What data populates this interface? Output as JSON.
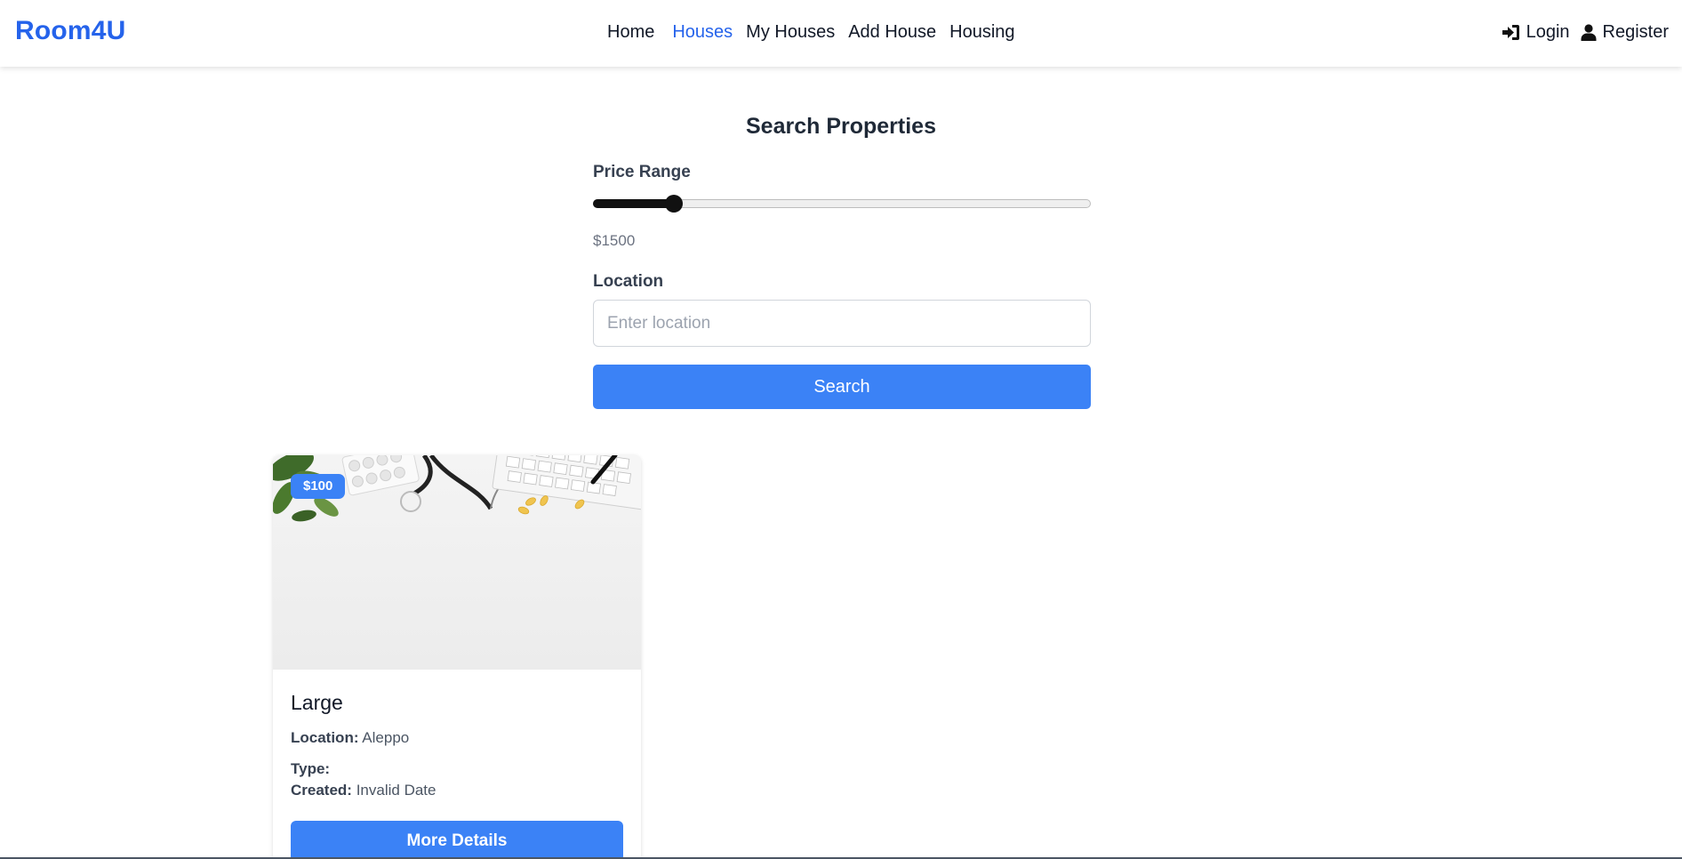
{
  "navbar": {
    "brand": "Room4U",
    "links": [
      {
        "label": "Home",
        "active": false
      },
      {
        "label": "Houses",
        "active": true
      },
      {
        "label": "My Houses",
        "active": false
      },
      {
        "label": "Add House",
        "active": false
      },
      {
        "label": "Housing",
        "active": false
      }
    ],
    "login_label": "Login",
    "register_label": "Register",
    "login_icon": "sign-in-icon",
    "register_icon": "user-icon"
  },
  "search": {
    "title": "Search Properties",
    "price_label": "Price Range",
    "price_value_text": "$1500",
    "price_slider_fraction": 0.163,
    "location_label": "Location",
    "location_value": "",
    "location_placeholder": "Enter location",
    "button_label": "Search"
  },
  "listings": [
    {
      "price": "$100",
      "title": "Large",
      "location_label": "Location:",
      "location": "Aleppo",
      "type_label": "Type:",
      "type": "",
      "created_label": "Created:",
      "created": "Invalid Date",
      "button_label": "More Details"
    }
  ],
  "colors": {
    "accent": "#3b82f6",
    "brand": "#2563eb",
    "slider": "#111111"
  }
}
